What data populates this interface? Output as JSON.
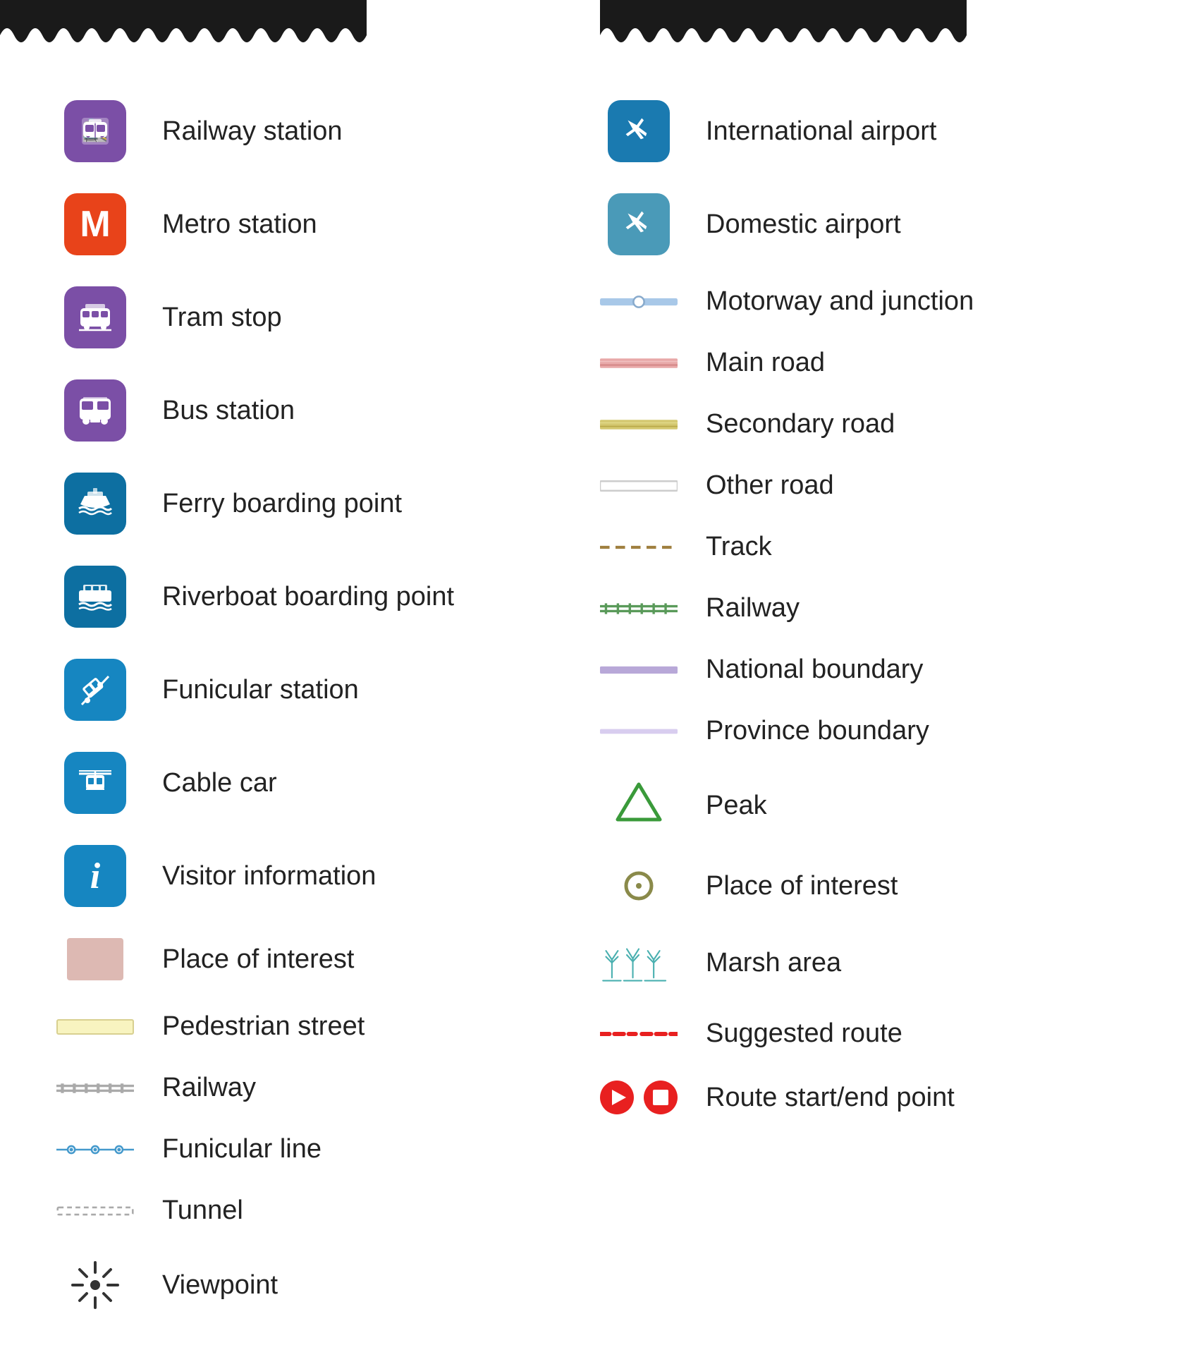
{
  "banners": {
    "left_visible": true,
    "right_visible": true
  },
  "left_column": {
    "items": [
      {
        "id": "railway-station",
        "label": "Railway station",
        "icon_type": "svg_railway"
      },
      {
        "id": "metro-station",
        "label": "Metro station",
        "icon_type": "svg_metro"
      },
      {
        "id": "tram-stop",
        "label": "Tram stop",
        "icon_type": "svg_tram"
      },
      {
        "id": "bus-station",
        "label": "Bus station",
        "icon_type": "svg_bus"
      },
      {
        "id": "ferry-boarding",
        "label": "Ferry boarding point",
        "icon_type": "svg_ferry"
      },
      {
        "id": "riverboat-boarding",
        "label": "Riverboat boarding point",
        "icon_type": "svg_riverboat"
      },
      {
        "id": "funicular-station",
        "label": "Funicular station",
        "icon_type": "svg_funicular_station"
      },
      {
        "id": "cable-car",
        "label": "Cable car",
        "icon_type": "svg_cable_car"
      },
      {
        "id": "visitor-info",
        "label": "Visitor information",
        "icon_type": "svg_info"
      },
      {
        "id": "place-of-interest-box",
        "label": "Place of interest",
        "icon_type": "poi_rect"
      },
      {
        "id": "pedestrian-street",
        "label": "Pedestrian street",
        "icon_type": "pedestrian_line"
      },
      {
        "id": "railway-line",
        "label": "Railway",
        "icon_type": "railway_gray_line"
      },
      {
        "id": "funicular-line",
        "label": "Funicular line",
        "icon_type": "funicular_line"
      },
      {
        "id": "tunnel",
        "label": "Tunnel",
        "icon_type": "tunnel_line"
      },
      {
        "id": "viewpoint",
        "label": "Viewpoint",
        "icon_type": "viewpoint_symbol"
      }
    ]
  },
  "right_column": {
    "items": [
      {
        "id": "intl-airport",
        "label": "International airport",
        "icon_type": "svg_intl_airport"
      },
      {
        "id": "dom-airport",
        "label": "Domestic airport",
        "icon_type": "svg_dom_airport"
      },
      {
        "id": "motorway",
        "label": "Motorway and junction",
        "icon_type": "motorway_line"
      },
      {
        "id": "main-road",
        "label": "Main road",
        "icon_type": "main_road_line"
      },
      {
        "id": "secondary-road",
        "label": "Secondary road",
        "icon_type": "secondary_road_line"
      },
      {
        "id": "other-road",
        "label": "Other road",
        "icon_type": "other_road_line"
      },
      {
        "id": "track",
        "label": "Track",
        "icon_type": "track_line"
      },
      {
        "id": "railway-symbol",
        "label": "Railway",
        "icon_type": "railway_green_line"
      },
      {
        "id": "national-boundary",
        "label": "National boundary",
        "icon_type": "national_boundary_line"
      },
      {
        "id": "province-boundary",
        "label": "Province boundary",
        "icon_type": "province_boundary_line"
      },
      {
        "id": "peak",
        "label": "Peak",
        "icon_type": "peak_triangle"
      },
      {
        "id": "place-of-interest-circle",
        "label": "Place of interest",
        "icon_type": "poi_circle"
      },
      {
        "id": "marsh-area",
        "label": "Marsh area",
        "icon_type": "marsh_symbol"
      },
      {
        "id": "suggested-route",
        "label": "Suggested route",
        "icon_type": "suggested_route_line"
      },
      {
        "id": "route-start-end",
        "label": "Route start/end point",
        "icon_type": "route_points"
      }
    ]
  }
}
